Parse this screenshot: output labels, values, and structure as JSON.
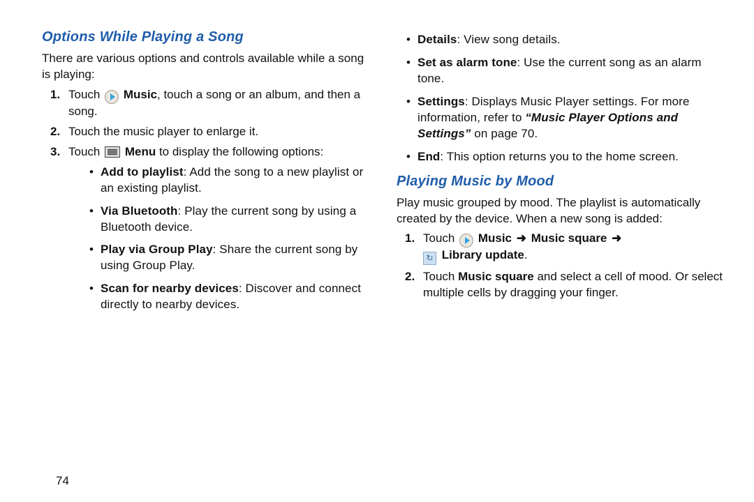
{
  "page_number": "74",
  "left": {
    "heading": "Options While Playing a Song",
    "intro": "There are various options and controls available while a song is playing:",
    "step1_a": "Touch ",
    "step1_b": "Music",
    "step1_c": ", touch a song or an album, and then a song.",
    "step2": "Touch the music player to enlarge it.",
    "step3_a": "Touch ",
    "step3_b": "Menu",
    "step3_c": " to display the following options:",
    "opt1_b": "Add to playlist",
    "opt1_t": ": Add the song to a new playlist or an existing playlist.",
    "opt2_b": "Via Bluetooth",
    "opt2_t": ": Play the current song by using a Bluetooth device.",
    "opt3_b": "Play via Group Play",
    "opt3_t": ": Share the current song by using Group Play.",
    "opt4_b": "Scan for nearby devices",
    "opt4_t": ": Discover and connect directly to nearby devices."
  },
  "right": {
    "opt5_b": "Details",
    "opt5_t": ": View song details.",
    "opt6_b": "Set as alarm tone",
    "opt6_t": ": Use the current song as an alarm tone.",
    "opt7_b": "Settings",
    "opt7_t1": ": Displays Music Player settings. For more information, refer to ",
    "opt7_ref": "“Music Player Options and Settings”",
    "opt7_t2": " on page 70.",
    "opt8_b": "End",
    "opt8_t": ": This option returns you to the home screen.",
    "heading2": "Playing Music by Mood",
    "intro2": "Play music grouped by mood. The playlist is automatically created by the device. When a new song is added:",
    "s1_a": "Touch ",
    "s1_b": "Music",
    "s1_arrow": "➜",
    "s1_c": "Music square",
    "s1_d": "Library update",
    "s1_dot": ".",
    "s2_a": "Touch ",
    "s2_b": "Music square",
    "s2_c": " and select a cell of mood. Or select multiple cells by dragging your finger."
  }
}
